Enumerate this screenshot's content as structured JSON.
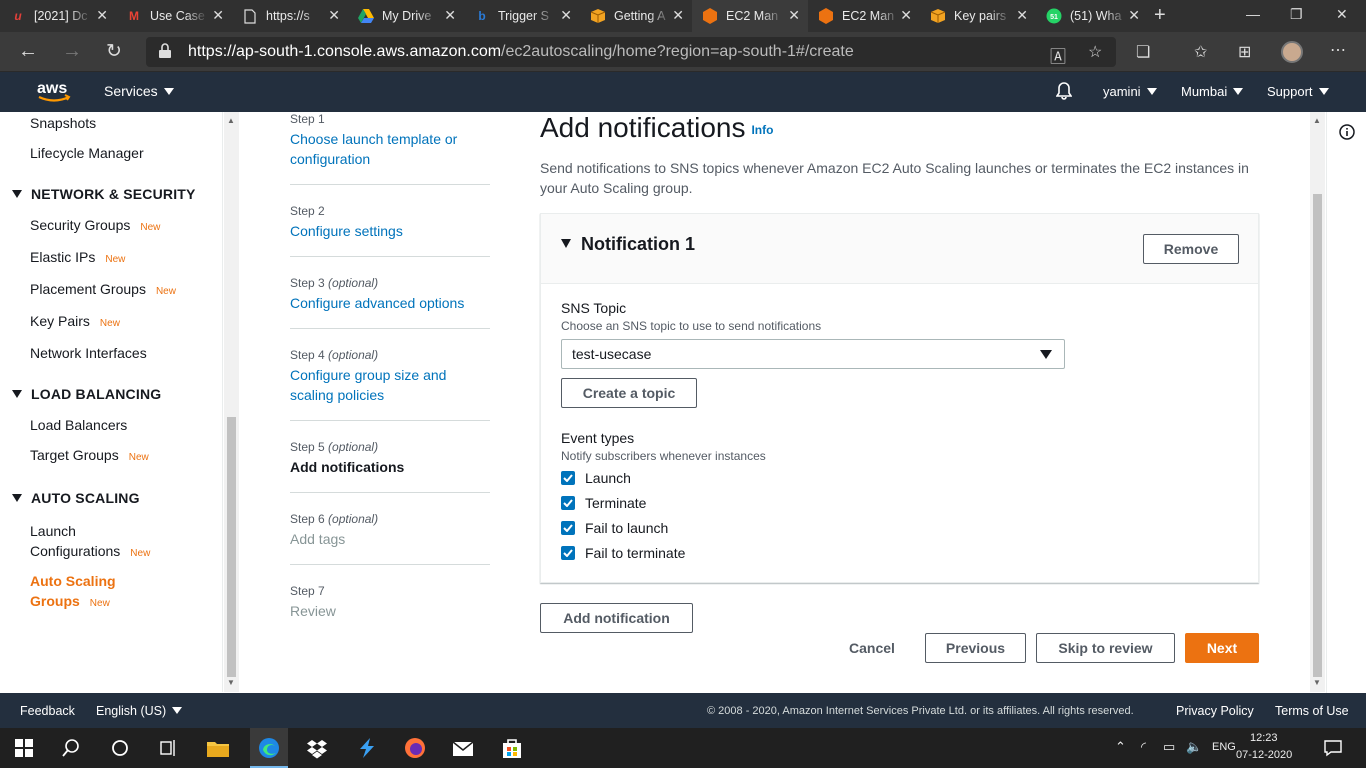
{
  "browser": {
    "tabs": [
      {
        "title": "[2021] Dc",
        "icon": "u-icon",
        "color": "#e0403a",
        "glyph": "u"
      },
      {
        "title": "Use Case",
        "icon": "gmail-icon",
        "color": "#ea4335",
        "glyph": "M"
      },
      {
        "title": "https://s",
        "icon": "page-icon",
        "color": "#dddddd",
        "glyph": ""
      },
      {
        "title": "My Drive",
        "icon": "drive-icon",
        "color": "#1fa463",
        "glyph": ""
      },
      {
        "title": "Trigger S",
        "icon": "bing-icon",
        "color": "#2a7bd8",
        "glyph": "b"
      },
      {
        "title": "Getting A",
        "icon": "aws-box-icon",
        "color": "#f2a322",
        "glyph": ""
      },
      {
        "title": "EC2 Man",
        "icon": "ec2-icon",
        "color": "#ec7211",
        "glyph": "",
        "active": true
      },
      {
        "title": "EC2 Man",
        "icon": "ec2-icon",
        "color": "#ec7211",
        "glyph": ""
      },
      {
        "title": "Key pairs",
        "icon": "aws-box-icon",
        "color": "#f2a322",
        "glyph": ""
      },
      {
        "title": "(51) Wha",
        "icon": "whatsapp-icon",
        "color": "#25d366",
        "glyph": "51"
      }
    ],
    "url_host": "https://ap-south-1.console.aws.amazon.com",
    "url_path": "/ec2autoscaling/home?region=ap-south-1#/create"
  },
  "aws_header": {
    "logo": "aws",
    "services": "Services",
    "user": "yamini",
    "region": "Mumbai",
    "support": "Support"
  },
  "sidebar": {
    "snapshots": "Snapshots",
    "lifecycle": "Lifecycle Manager",
    "network_head": "NETWORK & SECURITY",
    "security_groups": "Security Groups",
    "elastic_ips": "Elastic IPs",
    "placement_groups": "Placement Groups",
    "key_pairs": "Key Pairs",
    "network_interfaces": "Network Interfaces",
    "lb_head": "LOAD BALANCING",
    "load_balancers": "Load Balancers",
    "target_groups": "Target Groups",
    "as_head": "AUTO SCALING",
    "launch_configs_1": "Launch",
    "launch_configs_2": "Configurations",
    "asg_1": "Auto Scaling",
    "asg_2": "Groups",
    "new_badge": "New"
  },
  "steps": [
    {
      "num": "Step 1",
      "opt": "",
      "label": "Choose launch template or configuration"
    },
    {
      "num": "Step 2",
      "opt": "",
      "label": "Configure settings"
    },
    {
      "num": "Step 3",
      "opt": "(optional)",
      "label": "Configure advanced options"
    },
    {
      "num": "Step 4",
      "opt": "(optional)",
      "label": "Configure group size and scaling policies"
    },
    {
      "num": "Step 5",
      "opt": "(optional)",
      "label": "Add notifications"
    },
    {
      "num": "Step 6",
      "opt": "(optional)",
      "label": "Add tags"
    },
    {
      "num": "Step 7",
      "opt": "",
      "label": "Review"
    }
  ],
  "main": {
    "title": "Add notifications",
    "info": "Info",
    "description": "Send notifications to SNS topics whenever Amazon EC2 Auto Scaling launches or terminates the EC2 instances in your Auto Scaling group.",
    "panel_title": "Notification 1",
    "remove": "Remove",
    "sns_label": "SNS Topic",
    "sns_hint": "Choose an SNS topic to use to send notifications",
    "sns_value": "test-usecase",
    "create_topic": "Create a topic",
    "events_label": "Event types",
    "events_hint": "Notify subscribers whenever instances",
    "events": [
      "Launch",
      "Terminate",
      "Fail to launch",
      "Fail to terminate"
    ],
    "add_notification": "Add notification",
    "cancel": "Cancel",
    "previous": "Previous",
    "skip": "Skip to review",
    "next": "Next"
  },
  "footer": {
    "feedback": "Feedback",
    "language": "English (US)",
    "copyright": "© 2008 - 2020, Amazon Internet Services Private Ltd. or its affiliates. All rights reserved.",
    "privacy": "Privacy Policy",
    "terms": "Terms of Use"
  },
  "taskbar": {
    "lang": "ENG",
    "time": "12:23",
    "date": "07-12-2020"
  },
  "colors": {
    "aws_nav": "#232f3e",
    "accent": "#ec7211",
    "link": "#0073bb"
  }
}
